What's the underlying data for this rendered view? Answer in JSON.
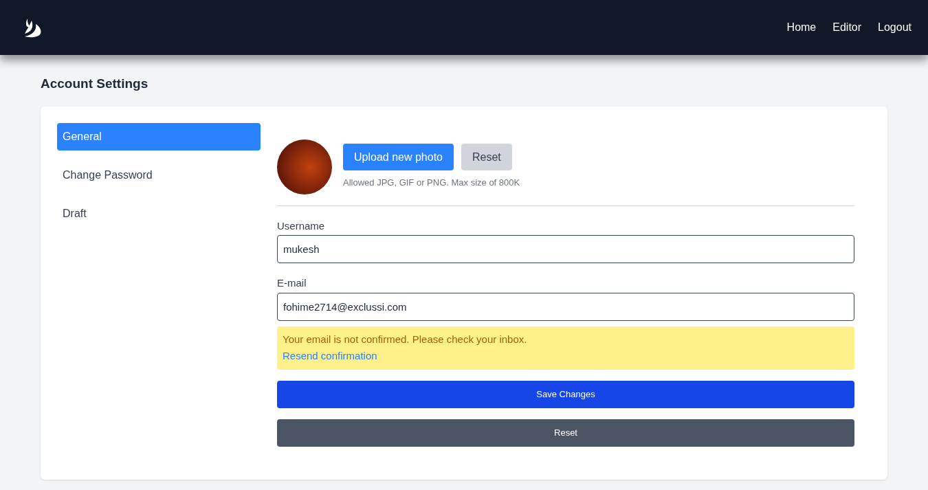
{
  "nav": {
    "links": [
      "Home",
      "Editor",
      "Logout"
    ]
  },
  "page_title": "Account Settings",
  "sidebar": {
    "items": [
      {
        "label": "General",
        "selected": true
      },
      {
        "label": "Change Password",
        "selected": false
      },
      {
        "label": "Draft",
        "selected": false
      }
    ]
  },
  "photo": {
    "upload_button": "Upload new photo",
    "reset_button": "Reset",
    "hint": "Allowed JPG, GIF or PNG. Max size of 800K"
  },
  "fields": [
    {
      "label": "Username",
      "value": "mukesh"
    },
    {
      "label": "E-mail",
      "value": "fohime2714@exclussi.com"
    }
  ],
  "alert": {
    "message": "Your email is not confirmed. Please check your inbox.",
    "link": "Resend confirmation"
  },
  "save_button": "Save Changes",
  "reset_button": "Reset"
}
